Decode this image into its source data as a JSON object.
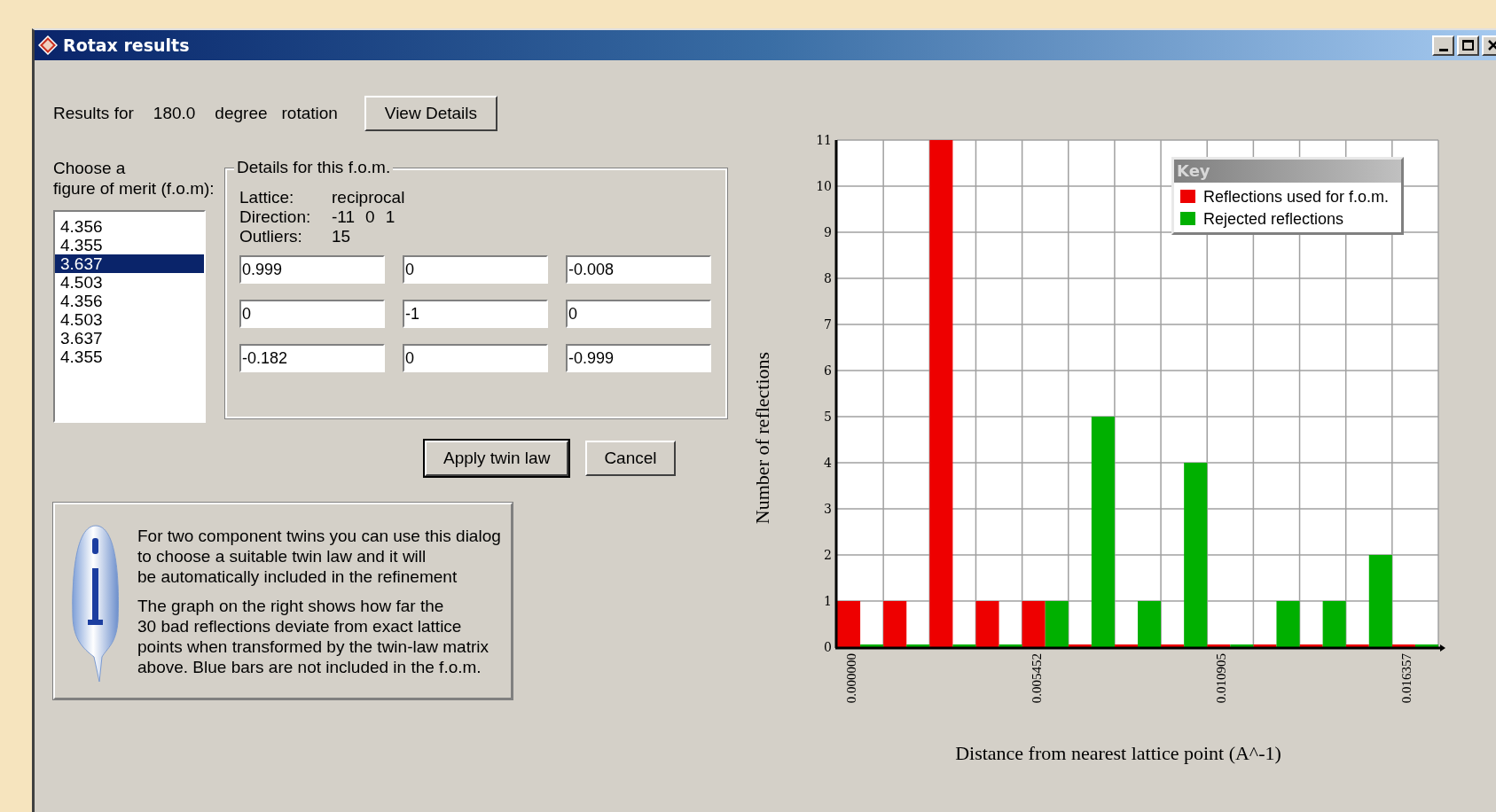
{
  "window": {
    "title": "Rotax results"
  },
  "header": {
    "label": "Results for",
    "angle": "180.0",
    "unit": "degree",
    "motion": "rotation"
  },
  "view_details_button": "View Details",
  "fom_list": {
    "label_lines": [
      "Choose a",
      "figure of merit (f.o.m):"
    ],
    "items": [
      {
        "value": "4.356",
        "selected": false
      },
      {
        "value": "4.355",
        "selected": false
      },
      {
        "value": "3.637",
        "selected": true
      },
      {
        "value": "4.503",
        "selected": false
      },
      {
        "value": "4.356",
        "selected": false
      },
      {
        "value": "4.503",
        "selected": false
      },
      {
        "value": "3.637",
        "selected": false
      },
      {
        "value": "4.355",
        "selected": false
      }
    ]
  },
  "details": {
    "title": "Details for this f.o.m.",
    "rows": [
      {
        "label": "Lattice:",
        "values": [
          "reciprocal"
        ]
      },
      {
        "label": "Direction:",
        "values": [
          "-11",
          "0",
          "1"
        ]
      },
      {
        "label": "Outliers:",
        "values": [
          "15"
        ]
      }
    ],
    "matrix": [
      [
        "0.999",
        "0",
        "-0.008"
      ],
      [
        "0",
        "-1",
        "0"
      ],
      [
        "-0.182",
        "0",
        "-0.999"
      ]
    ]
  },
  "buttons": [
    {
      "label": "Apply twin law",
      "default": true
    },
    {
      "label": "Cancel",
      "default": false
    }
  ],
  "info": {
    "paragraphs": [
      [
        "For two component twins you can use this dialog",
        "to choose a suitable twin law and it will",
        "be automatically included in the refinement"
      ],
      [
        "The graph on the right shows how far the",
        "30 bad reflections deviate from exact lattice",
        "points when transformed by the twin-law matrix",
        "above. Blue bars are not included in the f.o.m."
      ]
    ]
  },
  "chart": {
    "chart_data": {
      "type": "bar",
      "xlabel": "Distance from nearest lattice point (A^-1)",
      "ylabel": "Number of reflections",
      "categories": [
        "0.000000",
        null,
        null,
        null,
        "0.005452",
        null,
        null,
        null,
        "0.010905",
        null,
        null,
        null,
        "0.016357"
      ],
      "series": [
        {
          "name": "Reflections used for f.o.m.",
          "color": "#ee0000",
          "values": [
            1,
            1,
            11,
            1,
            1,
            0,
            0,
            0,
            0,
            0,
            0,
            0,
            0
          ]
        },
        {
          "name": "Rejected reflections",
          "color": "#00b000",
          "values": [
            0,
            0,
            0,
            0,
            1,
            5,
            1,
            4,
            0,
            1,
            1,
            2,
            0
          ]
        }
      ],
      "ylim": [
        0,
        11
      ],
      "yticks": [
        0,
        1,
        2,
        3,
        4,
        5,
        6,
        7,
        8,
        9,
        10,
        11
      ],
      "grid": true,
      "legend": {
        "title": "Key"
      }
    }
  }
}
